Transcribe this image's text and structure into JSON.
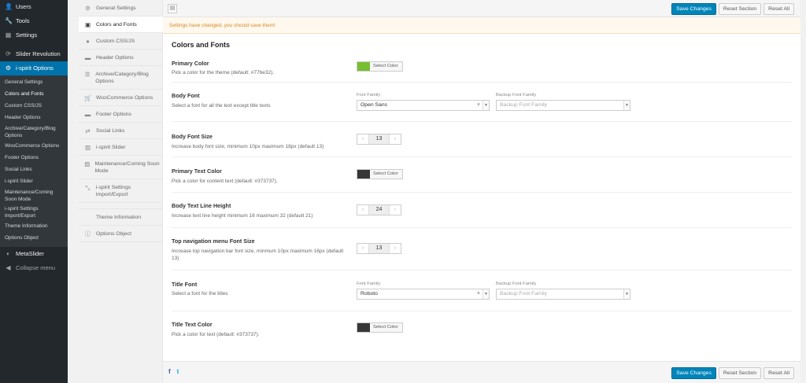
{
  "wp_menu": {
    "top_items": [
      {
        "label": "Users",
        "icon": "users-icon"
      },
      {
        "label": "Tools",
        "icon": "tools-icon"
      },
      {
        "label": "Settings",
        "icon": "settings-icon"
      },
      {
        "label": "Slider Revolution",
        "icon": "slider-revolution-icon"
      },
      {
        "label": "i-spirit Options",
        "icon": "gear-icon"
      }
    ],
    "sub_items": [
      "General Settings",
      "Colors and Fonts",
      "Custom CSS/JS",
      "Header Options",
      "Archive/Category/Blog Options",
      "WooCommerce Options",
      "Footer Options",
      "Social Links",
      "i-spirit Slider",
      "Maintenance/Coming Soon Mode",
      "i-spirit Settings Import/Export",
      "Theme Information",
      "Options Object"
    ],
    "metaslider": "MetaSlider",
    "collapse": "Collapse menu"
  },
  "redux_nav": [
    {
      "label": "General Settings",
      "icon": "gears-icon"
    },
    {
      "label": "Colors and Fonts",
      "icon": "palette-icon"
    },
    {
      "label": "Custom CSS/JS",
      "icon": "code-icon"
    },
    {
      "label": "Header Options",
      "icon": "header-icon"
    },
    {
      "label": "Archive/Category/Blog Options",
      "icon": "list-icon"
    },
    {
      "label": "WooCommerce Options",
      "icon": "cart-icon"
    },
    {
      "label": "Footer Options",
      "icon": "footer-icon"
    },
    {
      "label": "Social Links",
      "icon": "share-icon"
    },
    {
      "label": "i-spirit Slider",
      "icon": "image-icon"
    },
    {
      "label": "Maintenance/Coming Soon Mode",
      "icon": "image-icon"
    },
    {
      "label": "i-spirit Settings Import/Export",
      "icon": "refresh-icon"
    },
    {
      "label": "Theme Information",
      "icon": ""
    },
    {
      "label": "Options Object",
      "icon": "info-icon"
    }
  ],
  "toolbar": {
    "save": "Save Changes",
    "reset_section": "Reset Section",
    "reset_all": "Reset All"
  },
  "notice": "Settings have changed, you should save them!",
  "section_title": "Colors and Fonts",
  "fields": {
    "primary_color": {
      "label": "Primary Color",
      "desc": "Pick a color for the theme (default: #77be32).",
      "color": "#77be32",
      "btn": "Select Color"
    },
    "body_font": {
      "label": "Body Font",
      "desc": "Select a font for all the text except title texts",
      "ff_label": "Font Family",
      "backup_label": "Backup Font Family",
      "value": "Open Sans",
      "backup_placeholder": "Backup Font Family"
    },
    "body_font_size": {
      "label": "Body Font Size",
      "desc": "Increase body font size, minimum 10px maximum 18px (default 13)",
      "value": "13"
    },
    "primary_text_color": {
      "label": "Primary Text Color",
      "desc": "Pick a color for content text (default: #373737).",
      "color": "#373737",
      "btn": "Select Color"
    },
    "line_height": {
      "label": "Body Text Line Height",
      "desc": "Increase text line height minimum 16 maximum 32 (default 21)",
      "value": "24"
    },
    "topnav_size": {
      "label": "Top navigation menu Font Size",
      "desc": "Increase top navigation bar font size, minmum 10px maximum 16px (default 13)",
      "value": "13"
    },
    "title_font": {
      "label": "Title Font",
      "desc": "Select a font for the titles",
      "ff_label": "Font Family",
      "backup_label": "Backup Font Family",
      "value": "Roboto",
      "backup_placeholder": "Backup Font Family"
    },
    "title_text_color": {
      "label": "Title Text Color",
      "desc": "Pick a color for text (default: #373737).",
      "color": "#373737",
      "btn": "Select Color"
    }
  },
  "social": {
    "facebook": "f",
    "twitter": "t"
  }
}
